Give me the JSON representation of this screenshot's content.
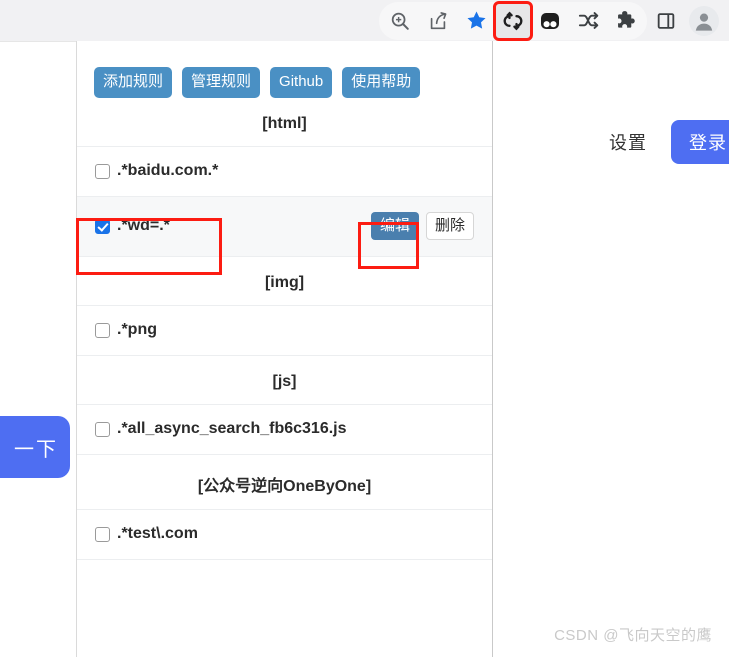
{
  "browser_toolbar": {
    "icons": [
      {
        "name": "zoom-search-icon",
        "label": "Search with Google Lens"
      },
      {
        "name": "share-icon",
        "label": "Share this page"
      },
      {
        "name": "bookmark-star-icon",
        "label": "Bookmark this tab"
      },
      {
        "name": "loop-extension-icon",
        "label": "ReplaceRule extension",
        "active": true,
        "highlight_color": "#fc1c12"
      },
      {
        "name": "panda-extension-icon",
        "label": "Extension"
      },
      {
        "name": "shuffle-extension-icon",
        "label": "Extension"
      },
      {
        "name": "puzzle-extensions-icon",
        "label": "Extensions"
      },
      {
        "name": "side-panel-icon",
        "label": "Side panel"
      },
      {
        "name": "profile-avatar-icon",
        "label": "Profile"
      }
    ]
  },
  "page": {
    "settings_label": "设置",
    "login_label": "登录",
    "search_button_label": "一下",
    "watermark": "CSDN @飞向天空的鹰",
    "accent_color": "#4e6ef2"
  },
  "popup": {
    "accent_color": "#4a90c4",
    "actions": [
      {
        "label": "添加规则",
        "name": "add-rule-button"
      },
      {
        "label": "管理规则",
        "name": "manage-rules-button"
      },
      {
        "label": "Github",
        "name": "github-button"
      },
      {
        "label": "使用帮助",
        "name": "help-button"
      }
    ],
    "sections": [
      {
        "title": "[html]",
        "rules": [
          {
            "pattern": ".*baidu.com.*",
            "checked": false,
            "selected": false,
            "edit_label": "",
            "delete_label": ""
          },
          {
            "pattern": ".*wd=.*",
            "checked": true,
            "selected": true,
            "edit_label": "编辑",
            "delete_label": "删除"
          }
        ]
      },
      {
        "title": "[img]",
        "rules": [
          {
            "pattern": ".*png",
            "checked": false,
            "selected": false,
            "edit_label": "",
            "delete_label": ""
          }
        ]
      },
      {
        "title": "[js]",
        "rules": [
          {
            "pattern": ".*all_async_search_fb6c316.js",
            "checked": false,
            "selected": false,
            "edit_label": "",
            "delete_label": ""
          }
        ]
      },
      {
        "title": "[公众号逆向OneByOne]",
        "rules": [
          {
            "pattern": ".*test\\.com",
            "checked": false,
            "selected": false,
            "edit_label": "",
            "delete_label": ""
          }
        ]
      }
    ]
  }
}
